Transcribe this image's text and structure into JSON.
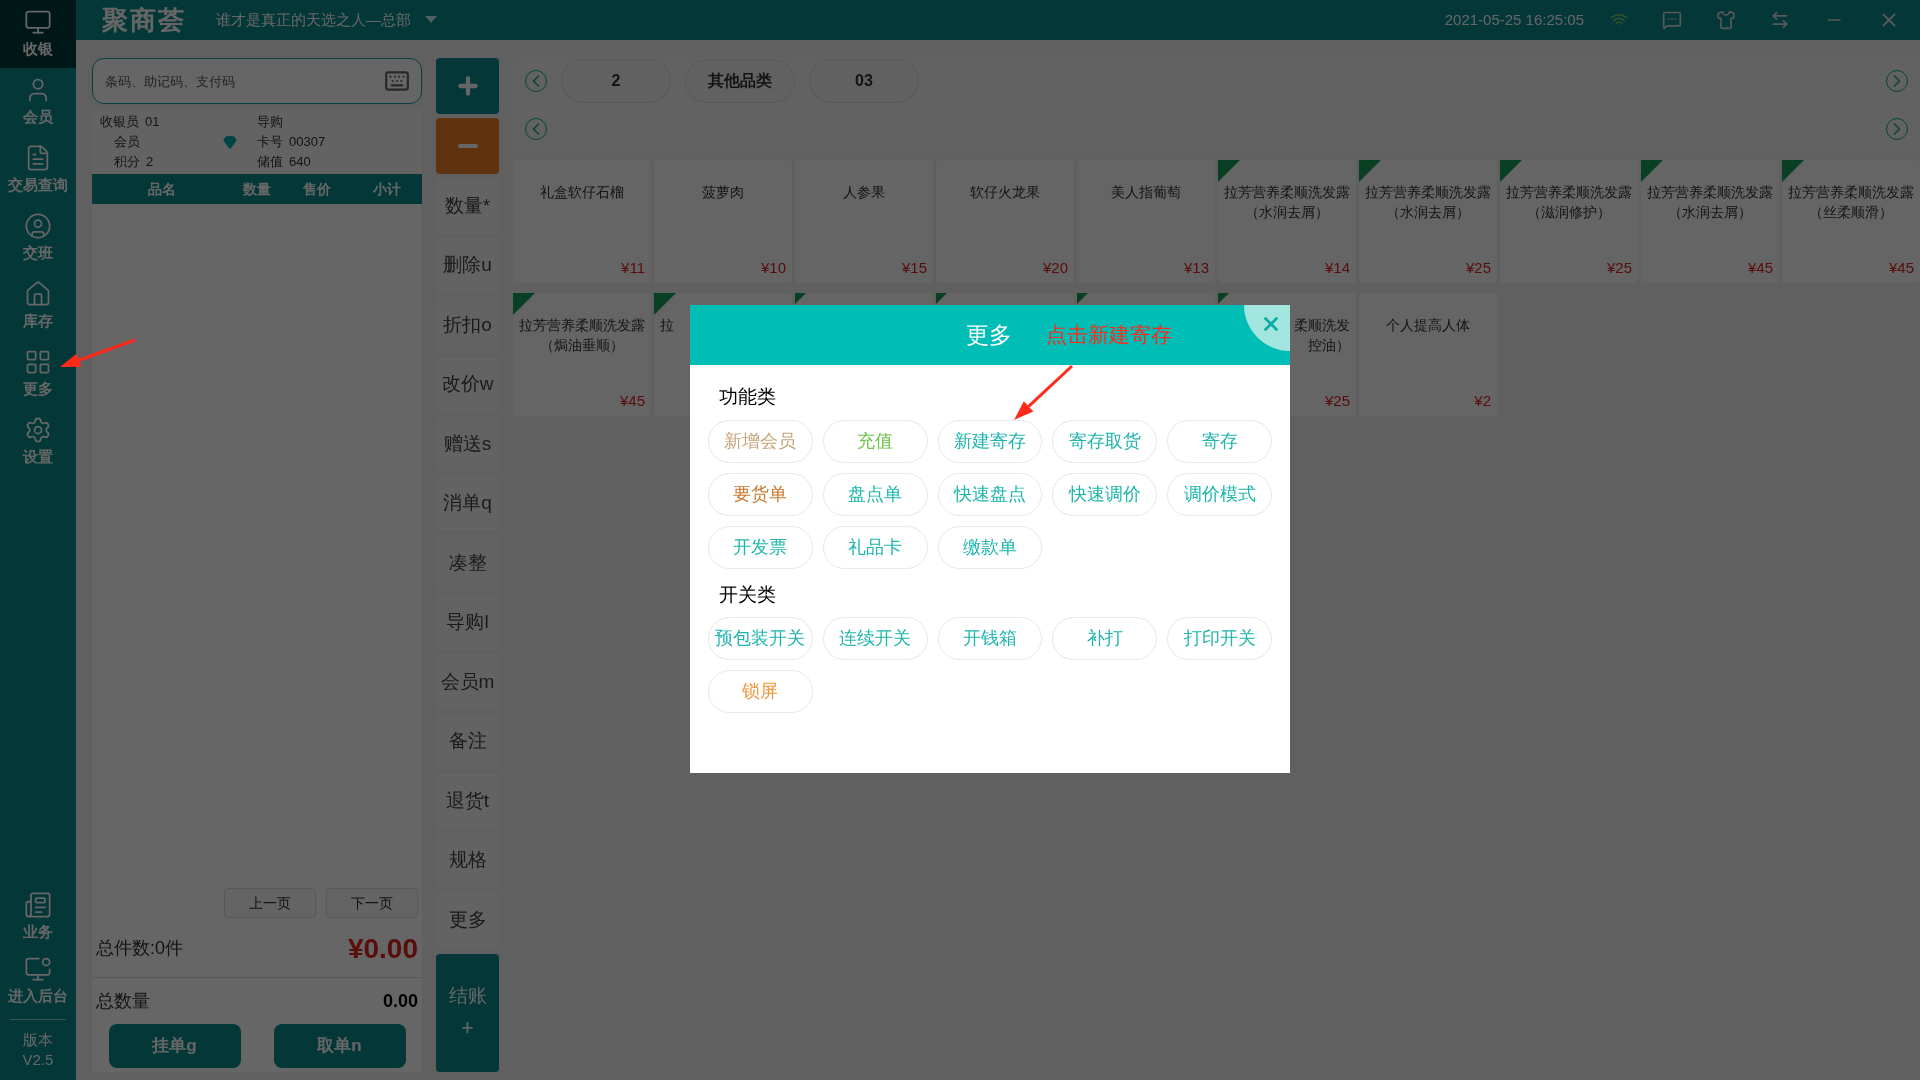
{
  "top_bar": {
    "logo": "聚商荟",
    "store": "谁才是真正的天选之人—总部",
    "datetime": "2021-05-25 16:25:05"
  },
  "sidebar": {
    "items": [
      {
        "label": "收银",
        "selected": true
      },
      {
        "label": "会员",
        "selected": false
      },
      {
        "label": "交易查询",
        "selected": false
      },
      {
        "label": "交班",
        "selected": false
      },
      {
        "label": "库存",
        "selected": false
      },
      {
        "label": "更多",
        "selected": false
      },
      {
        "label": "设置",
        "selected": false
      }
    ],
    "bottom_items": [
      {
        "label": "业务"
      },
      {
        "label": "进入后台"
      }
    ],
    "version": {
      "label": "版本",
      "value": "V2.5"
    }
  },
  "search": {
    "placeholder": "条码、助记码、支付码"
  },
  "info": [
    {
      "label": "收银员",
      "value": "01"
    },
    {
      "label": "导购"
    },
    {
      "label": "会员",
      "kind": "member"
    },
    {
      "label": "卡号",
      "value": "00307"
    },
    {
      "label": "积分",
      "value": "2"
    },
    {
      "label": "储值",
      "value": "640"
    }
  ],
  "cart": {
    "columns": [
      "品名",
      "数量",
      "售价",
      "小计"
    ]
  },
  "pager": [
    "上一页",
    "下一页"
  ],
  "totals": {
    "count": "总件数:0件",
    "amount": "¥0.00",
    "quantity_label": "总数量",
    "quantity": "0.00"
  },
  "footer_buttons": [
    "挂单g",
    "取单n"
  ],
  "actions": [
    "数量*",
    "删除u",
    "折扣o",
    "改价w",
    "赠送s",
    "消单q",
    "凑整",
    "导购l",
    "会员m",
    "备注",
    "退货t",
    "规格",
    "更多"
  ],
  "checkout": {
    "label": "结账",
    "hint": "+"
  },
  "categories": [
    "2",
    "其他品类",
    "03"
  ],
  "products": [
    {
      "kind": "full",
      "name": "礼盒软仔石榴",
      "price": "¥11",
      "new": false
    },
    {
      "kind": "full",
      "name": "菠萝肉",
      "price": "¥10",
      "new": false
    },
    {
      "kind": "full",
      "name": "人参果",
      "price": "¥15",
      "new": false
    },
    {
      "kind": "full",
      "name": "软仔火龙果",
      "price": "¥20",
      "new": false
    },
    {
      "kind": "full",
      "name": "美人指葡萄",
      "price": "¥13",
      "new": false
    },
    {
      "kind": "full",
      "name": "拉芳营养柔顺洗发露（水润去屑）",
      "price": "¥14",
      "new": true
    },
    {
      "kind": "full",
      "name": "拉芳营养柔顺洗发露（水润去屑）",
      "price": "¥25",
      "new": true
    },
    {
      "kind": "full",
      "name": "拉芳营养柔顺洗发露（滋润修护）",
      "price": "¥25",
      "new": true
    },
    {
      "kind": "full",
      "name": "拉芳营养柔顺洗发露（水润去屑）",
      "price": "¥45",
      "new": true
    },
    {
      "kind": "full",
      "name": "拉芳营养柔顺洗发露（丝柔顺滑）",
      "price": "¥45",
      "new": true
    },
    {
      "kind": "full",
      "name": "拉芳营养柔顺洗发露（焗油垂顺）",
      "price": "¥45",
      "new": true
    },
    {
      "kind": "left",
      "name": "拉",
      "new": true
    },
    {
      "kind": "hidden",
      "new": true
    },
    {
      "kind": "hidden",
      "new": true
    },
    {
      "kind": "hidden",
      "new": true
    },
    {
      "kind": "right",
      "name": "柔顺洗发控油）",
      "price": "¥25",
      "new": true
    },
    {
      "kind": "full",
      "name": "个人提高人体",
      "price": "¥2",
      "new": false
    }
  ],
  "modal": {
    "title": "更多",
    "note": "点击新建寄存",
    "sections": [
      {
        "title": "功能类",
        "buttons": [
          {
            "label": "新增会员",
            "color": "#c4a57a"
          },
          {
            "label": "充值",
            "color": "#6cc24a"
          },
          {
            "label": "新建寄存",
            "color": "#1fb5ad"
          },
          {
            "label": "寄存取货",
            "color": "#1fb5ad"
          },
          {
            "label": "寄存",
            "color": "#1fb5ad"
          },
          {
            "label": "要货单",
            "color": "#c8782e"
          },
          {
            "label": "盘点单",
            "color": "#1fb5ad"
          },
          {
            "label": "快速盘点",
            "color": "#1fb5ad"
          },
          {
            "label": "快速调价",
            "color": "#1fb5ad"
          },
          {
            "label": "调价模式",
            "color": "#1fb5ad"
          },
          {
            "label": "开发票",
            "color": "#1fb5ad"
          },
          {
            "label": "礼品卡",
            "color": "#1fb5ad"
          },
          {
            "label": "缴款单",
            "color": "#1fb5ad"
          }
        ]
      },
      {
        "title": "开关类",
        "buttons": [
          {
            "label": "预包装开关",
            "color": "#1fb5ad"
          },
          {
            "label": "连续开关",
            "color": "#1fb5ad"
          },
          {
            "label": "开钱箱",
            "color": "#1fb5ad"
          },
          {
            "label": "补打",
            "color": "#1fb5ad"
          },
          {
            "label": "打印开关",
            "color": "#1fb5ad"
          },
          {
            "label": "锁屏",
            "color": "#f0953a"
          }
        ]
      }
    ]
  }
}
